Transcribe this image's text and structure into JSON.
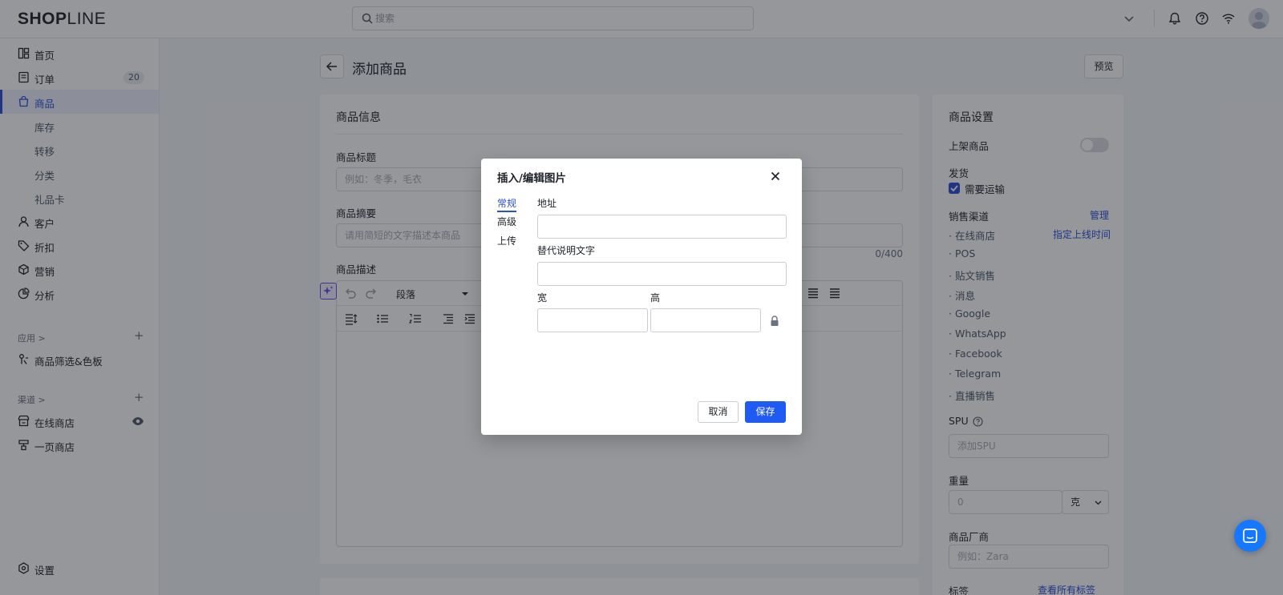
{
  "topbar": {
    "logo_bold": "SHOP",
    "logo_light": "LINE",
    "search_placeholder": "搜索"
  },
  "sidebar": {
    "items": [
      {
        "label": "首页",
        "icon": "dashboard-icon"
      },
      {
        "label": "订单",
        "icon": "order-icon",
        "badge": "20"
      },
      {
        "label": "商品",
        "icon": "bag-icon",
        "active": true
      },
      {
        "label": "库存",
        "sub": true
      },
      {
        "label": "转移",
        "sub": true
      },
      {
        "label": "分类",
        "sub": true
      },
      {
        "label": "礼品卡",
        "sub": true
      },
      {
        "label": "客户",
        "icon": "user-icon"
      },
      {
        "label": "折扣",
        "icon": "tag-icon"
      },
      {
        "label": "营销",
        "icon": "marketing-icon"
      },
      {
        "label": "分析",
        "icon": "chart-icon"
      }
    ],
    "apps_header": "应用 >",
    "apps": [
      {
        "label": "商品筛选&色板",
        "icon": "filter-app-icon"
      }
    ],
    "channels_header": "渠道 >",
    "channels": [
      {
        "label": "在线商店",
        "icon": "store-icon"
      },
      {
        "label": "一页商店",
        "icon": "onepage-icon"
      }
    ],
    "settings_label": "设置"
  },
  "main": {
    "page_title": "添加商品",
    "preview_label": "预览",
    "product_info_header": "商品信息",
    "title_label": "商品标题",
    "title_placeholder": "例如：冬季，毛衣",
    "summary_label": "商品摘要",
    "summary_placeholder": "请用简短的文字描述本商品",
    "summary_counter": "0/400",
    "description_label": "商品描述",
    "paragraph_select": "段落"
  },
  "settings_panel": {
    "header": "商品设置",
    "publish_label": "上架商品",
    "publish_on": false,
    "shipping_label": "发货",
    "requires_shipping_label": "需要运输",
    "requires_shipping_checked": true,
    "sales_channels_label": "销售渠道",
    "manage_link": "管理",
    "schedule_link": "指定上线时间",
    "channels": [
      "在线商店",
      "POS",
      "贴文销售",
      "消息",
      "Google",
      "WhatsApp",
      "Facebook",
      "Telegram",
      "直播销售"
    ],
    "spu_label": "SPU",
    "spu_placeholder": "添加SPU",
    "weight_label": "重量",
    "weight_placeholder": "0",
    "weight_unit": "克",
    "vendor_label": "商品厂商",
    "vendor_placeholder": "例如：Zara",
    "tags_label": "标签",
    "tags_link": "查看所有标签"
  },
  "modal": {
    "title": "插入/编辑图片",
    "tabs": [
      "常规",
      "高级",
      "上传"
    ],
    "active_tab": 0,
    "source_label": "地址",
    "source_value": "",
    "alt_label": "替代说明文字",
    "alt_value": "",
    "width_label": "宽",
    "width_value": "",
    "height_label": "高",
    "height_value": "",
    "cancel_label": "取消",
    "save_label": "保存"
  },
  "colors": {
    "accent": "#2b4fd8",
    "primary_button": "#1f5bf2",
    "chat_button": "#1677ff"
  }
}
